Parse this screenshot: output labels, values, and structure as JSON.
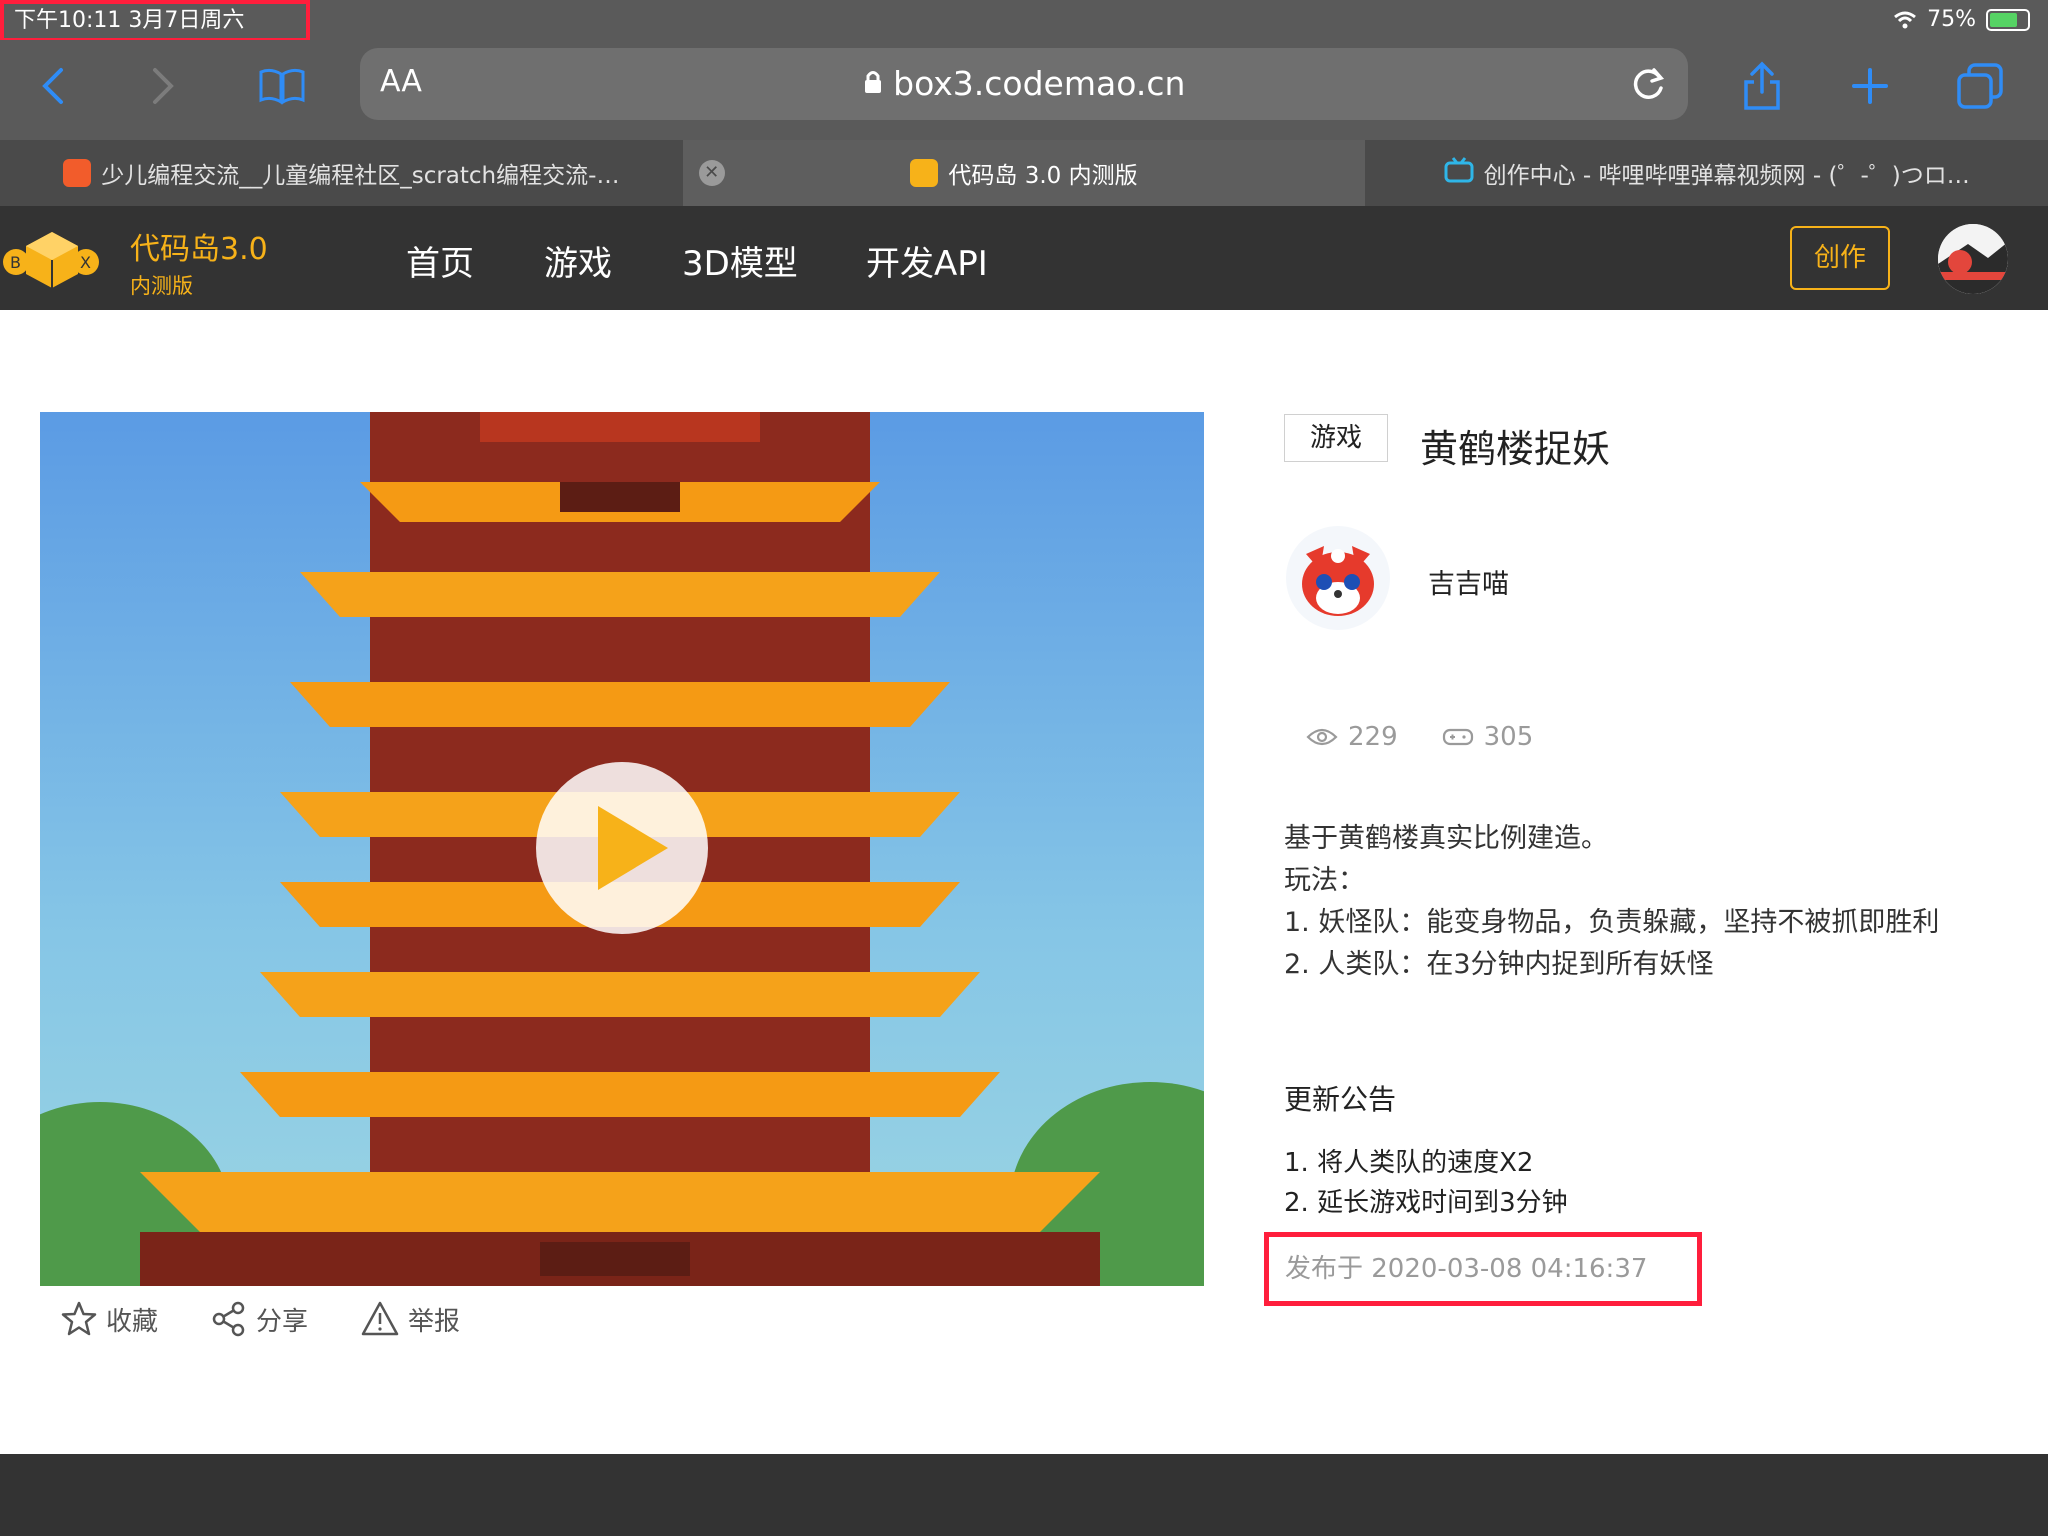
{
  "status_bar": {
    "time": "下午10:11   3月7日周六",
    "battery": "75%"
  },
  "browser": {
    "url": "box3.codemao.cn",
    "text_size_label": "AA",
    "tabs": [
      {
        "title": "少儿编程交流__儿童编程社区_scratch编程交流-…"
      },
      {
        "title": "代码岛 3.0 内测版"
      },
      {
        "title": "创作中心 - 哔哩哔哩弹幕视频网 - (゜-゜)つロ…"
      }
    ]
  },
  "site": {
    "logo_title": "代码岛3.0",
    "logo_subtitle": "内测版",
    "nav": [
      "首页",
      "游戏",
      "3D模型",
      "开发API"
    ],
    "create_button": "创作"
  },
  "game": {
    "tag": "游戏",
    "title": "黄鹤楼捉妖",
    "author": "吉吉喵",
    "views": "229",
    "plays": "305",
    "description": [
      "基于黄鹤楼真实比例建造。",
      "玩法：",
      "1. 妖怪队：能变身物品，负责躲藏，坚持不被抓即胜利",
      "2. 人类队：在3分钟内捉到所有妖怪"
    ],
    "notice_title": "更新公告",
    "notice": [
      "1. 将人类队的速度X2",
      "2. 延长游戏时间到3分钟"
    ],
    "published": "发布于 2020-03-08 04:16:37"
  },
  "actions": {
    "favorite": "收藏",
    "share": "分享",
    "report": "举报"
  },
  "colors": {
    "accent": "#f7b219",
    "header_bg": "#333333",
    "highlight": "#ff1e3c",
    "browser_blue": "#2f8cf6"
  }
}
